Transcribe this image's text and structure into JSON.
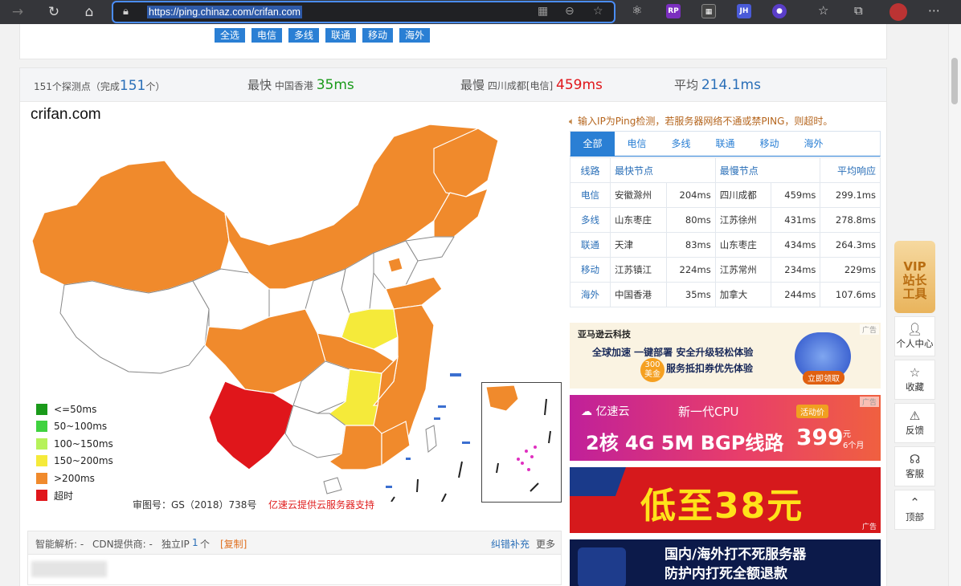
{
  "browser": {
    "url": "https://ping.chinaz.com/crifan.com",
    "ext_rp": "RP",
    "ext_jh": "JH"
  },
  "filters": [
    "全选",
    "电信",
    "多线",
    "联通",
    "移动",
    "海外"
  ],
  "stats": {
    "probes_prefix": "151个探测点（完成",
    "probes_done": "151",
    "probes_suffix": "个）",
    "fastest_label": "最快",
    "fastest_loc": "中国香港",
    "fastest_val": "35ms",
    "slowest_label": "最慢",
    "slowest_loc": "四川成都[电信]",
    "slowest_val": "459ms",
    "avg_label": "平均",
    "avg_val": "214.1ms"
  },
  "map": {
    "title": "crifan.com",
    "review_no": "审图号：GS（2018）738号",
    "support": "亿速云提供云服务器支持",
    "legend": [
      {
        "label": "<=50ms",
        "color": "#1a9a1a"
      },
      {
        "label": "50~100ms",
        "color": "#3fd23f"
      },
      {
        "label": "100~150ms",
        "color": "#b6f25a"
      },
      {
        "label": "150~200ms",
        "color": "#f5ea3a"
      },
      {
        "label": ">200ms",
        "color": "#f08a2c"
      },
      {
        "label": "超时",
        "color": "#e0161b"
      }
    ],
    "region_colors": {
      "over200": "#f08a2c",
      "mid": "#f5ea3a",
      "timeout": "#e0161b",
      "none": "#ffffff"
    }
  },
  "info": {
    "dns": "智能解析: -",
    "cdn": "CDN提供商: -",
    "ip_label": "独立IP",
    "ip_count": "1",
    "ip_unit": "个",
    "copy": "[复制]",
    "report": "纠错补充",
    "more": "更多"
  },
  "notice": "输入IP为Ping检测，若服务器网络不通或禁PING，则超时。",
  "tabs": [
    "全部",
    "电信",
    "多线",
    "联通",
    "移动",
    "海外"
  ],
  "table": {
    "headers": [
      "线路",
      "最快节点",
      "最慢节点",
      "平均响应"
    ],
    "rows": [
      {
        "line": "电信",
        "fast_loc": "安徽滁州",
        "fast_ms": "204ms",
        "slow_loc": "四川成都",
        "slow_ms": "459ms",
        "avg": "299.1ms"
      },
      {
        "line": "多线",
        "fast_loc": "山东枣庄",
        "fast_ms": "80ms",
        "slow_loc": "江苏徐州",
        "slow_ms": "431ms",
        "avg": "278.8ms"
      },
      {
        "line": "联通",
        "fast_loc": "天津",
        "fast_ms": "83ms",
        "slow_loc": "山东枣庄",
        "slow_ms": "434ms",
        "avg": "264.3ms"
      },
      {
        "line": "移动",
        "fast_loc": "江苏镇江",
        "fast_ms": "224ms",
        "slow_loc": "江苏常州",
        "slow_ms": "234ms",
        "avg": "229ms"
      },
      {
        "line": "海外",
        "fast_loc": "中国香港",
        "fast_ms": "35ms",
        "slow_loc": "加拿大",
        "slow_ms": "244ms",
        "avg": "107.6ms"
      }
    ]
  },
  "ads": {
    "tag": "广告",
    "ad1_brand": "亚马逊云科技",
    "ad1_line1": "全球加速 一键部署  安全升级轻松体验",
    "ad1_line2": "服务抵扣券优先体验",
    "ad1_badge": "300",
    "ad1_badge_unit": "美金",
    "ad1_cta": "立即领取",
    "ad2_brand": "亿速云",
    "ad2_slogan": "新一代CPU",
    "ad2_promo": "活动价",
    "ad2_spec": "2核 4G 5M BGP线路",
    "ad2_price": "399",
    "ad2_unit": "元",
    "ad2_period": "6个月",
    "ad3_text": "低至38元",
    "ad4_line1": "国内/海外打不死服务器",
    "ad4_line2": "防护内打死全额退款"
  },
  "float": {
    "vip_l1": "VIP",
    "vip_l2": "站长",
    "vip_l3": "工具",
    "personal": "个人中心",
    "favorite": "收藏",
    "feedback": "反馈",
    "service": "客服",
    "top": "顶部"
  }
}
